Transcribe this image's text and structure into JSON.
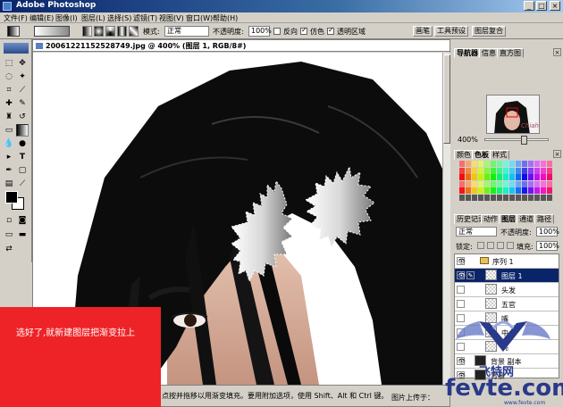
{
  "window": {
    "title": "Adobe Photoshop",
    "controls": {
      "minimize": "_",
      "maximize": "□",
      "close": "×"
    }
  },
  "menu": {
    "items": [
      "文件(F)",
      "编辑(E)",
      "图像(I)",
      "图层(L)",
      "选择(S)",
      "滤镜(T)",
      "视图(V)",
      "窗口(W)",
      "帮助(H)"
    ]
  },
  "options": {
    "mode_label": "模式:",
    "mode_value": "正常",
    "opacity_label": "不透明度:",
    "opacity_value": "100%",
    "reverse_label": "反向",
    "reverse_checked": false,
    "dither_label": "仿色",
    "dither_checked": true,
    "transparency_label": "透明区域",
    "transparency_checked": true,
    "palette_tabs": [
      "画笔",
      "工具预设",
      "图层复合"
    ]
  },
  "document": {
    "title": "20061221152528749.jpg @ 400% (图层 1, RGB/8#)",
    "status_text": "点按并拖移以用渐变填充。要用附加选项，使用 Shift、Alt 和 Ctrl 键。"
  },
  "note": {
    "text": "选好了,就新建图层把渐变拉上"
  },
  "navigator": {
    "tabs": [
      "导航器",
      "信息",
      "直方图"
    ],
    "zoom": "400%",
    "thumb_text": "Chiah"
  },
  "color_panel": {
    "tabs": [
      "颜色",
      "色板",
      "样式"
    ]
  },
  "layers_panel": {
    "tabs": [
      "历史记录",
      "动作",
      "图层",
      "通道",
      "路径"
    ],
    "blend_mode": "正常",
    "opacity_label": "不透明度:",
    "opacity_value": "100%",
    "lock_label": "锁定:",
    "fill_label": "填充:",
    "fill_value": "100%",
    "layers": [
      {
        "name": "序列 1",
        "type": "folder"
      },
      {
        "name": "图层 1",
        "type": "layer",
        "selected": true
      },
      {
        "name": "头发",
        "type": "layer"
      },
      {
        "name": "五官",
        "type": "layer"
      },
      {
        "name": "嘴",
        "type": "layer"
      },
      {
        "name": "中",
        "type": "layer"
      },
      {
        "name": "亮",
        "type": "layer"
      },
      {
        "name": "背景 副本",
        "type": "layer"
      },
      {
        "name": "背景",
        "type": "layer"
      }
    ]
  },
  "watermark": {
    "site_label": "图片上传于：",
    "brand_cn": "飞特网",
    "brand_en": "fevte.com",
    "brand_url": "www.fevte.com"
  },
  "colors": {
    "title_bar_start": "#0a246a",
    "note_bg": "#ee2327",
    "ui_gray": "#d4d0c8",
    "brand_blue": "#2a3a8a"
  }
}
